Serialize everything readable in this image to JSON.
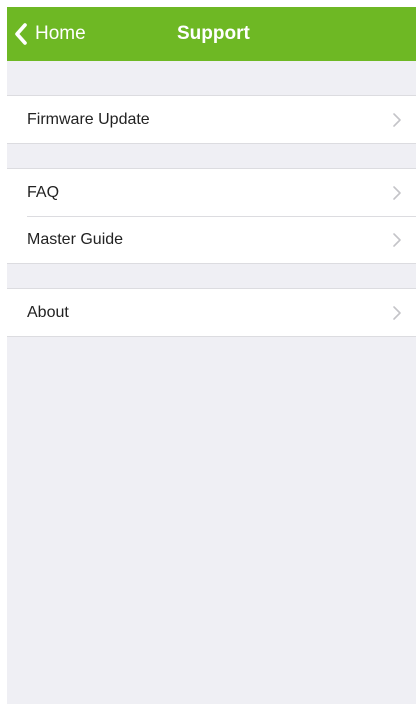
{
  "navbar": {
    "back_label": "Home",
    "title": "Support",
    "back_icon": "chevron-left-icon",
    "background_color": "#6eb824",
    "text_color": "#ffffff"
  },
  "groups": [
    {
      "items": [
        {
          "label": "Firmware Update",
          "icon": "chevron-right-icon"
        }
      ]
    },
    {
      "items": [
        {
          "label": "FAQ",
          "icon": "chevron-right-icon"
        },
        {
          "label": "Master Guide",
          "icon": "chevron-right-icon"
        }
      ]
    },
    {
      "items": [
        {
          "label": "About",
          "icon": "chevron-right-icon"
        }
      ]
    }
  ],
  "colors": {
    "page_background": "#efeff4",
    "cell_background": "#ffffff",
    "separator": "#dcdce0",
    "chevron": "#c4c4c8"
  }
}
